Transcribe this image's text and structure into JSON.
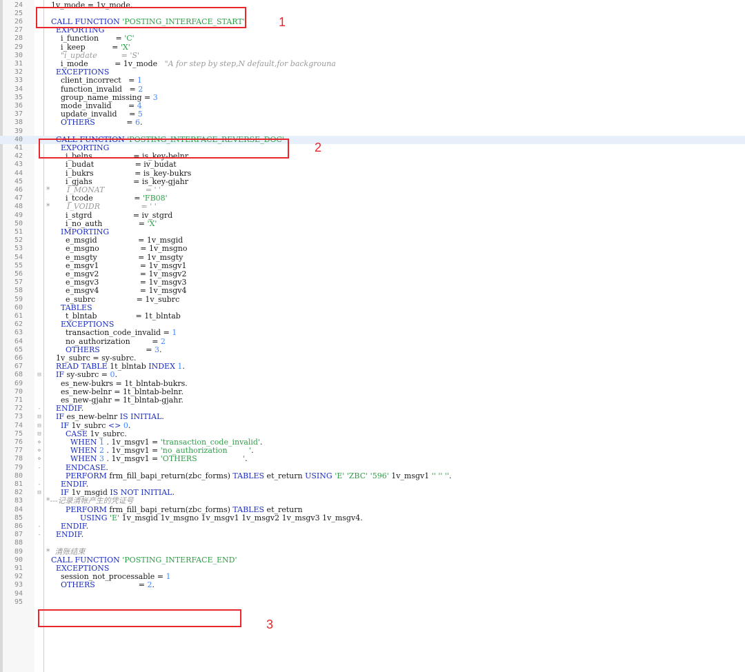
{
  "lines": [
    {
      "n": "24",
      "seg": [
        [
          "t",
          "  1v_mode = 1v_mode."
        ]
      ]
    },
    {
      "n": "25",
      "seg": []
    },
    {
      "n": "26",
      "seg": [
        [
          "t",
          "  "
        ],
        [
          "k",
          "CALL FUNCTION"
        ],
        [
          "t",
          " "
        ],
        [
          "s",
          "'POSTING_INTERFACE_START'"
        ]
      ]
    },
    {
      "n": "27",
      "seg": [
        [
          "t",
          "    "
        ],
        [
          "k",
          "EXPORTING"
        ]
      ]
    },
    {
      "n": "28",
      "seg": [
        [
          "t",
          "      i_function       = "
        ],
        [
          "s",
          "'C'"
        ]
      ]
    },
    {
      "n": "29",
      "seg": [
        [
          "t",
          "      i_keep           = "
        ],
        [
          "s",
          "'X'"
        ]
      ]
    },
    {
      "n": "30",
      "seg": [
        [
          "c",
          "      \"i_update          = 'S'"
        ]
      ]
    },
    {
      "n": "31",
      "seg": [
        [
          "t",
          "      i_mode           = 1v_mode   "
        ],
        [
          "c",
          "\"A for step by step,N default,for backgrouna"
        ]
      ]
    },
    {
      "n": "32",
      "seg": [
        [
          "t",
          "    "
        ],
        [
          "k",
          "EXCEPTIONS"
        ]
      ]
    },
    {
      "n": "33",
      "seg": [
        [
          "t",
          "      client_incorrect   = "
        ],
        [
          "n",
          "1"
        ]
      ]
    },
    {
      "n": "34",
      "seg": [
        [
          "t",
          "      function_invalid   = "
        ],
        [
          "n",
          "2"
        ]
      ]
    },
    {
      "n": "35",
      "seg": [
        [
          "t",
          "      group_name_missing = "
        ],
        [
          "n",
          "3"
        ]
      ]
    },
    {
      "n": "36",
      "seg": [
        [
          "t",
          "      mode_invalid       = "
        ],
        [
          "n",
          "4"
        ]
      ]
    },
    {
      "n": "37",
      "seg": [
        [
          "t",
          "      update_invalid     = "
        ],
        [
          "n",
          "5"
        ]
      ]
    },
    {
      "n": "38",
      "seg": [
        [
          "t",
          "      "
        ],
        [
          "k",
          "OTHERS"
        ],
        [
          "t",
          "             = "
        ],
        [
          "n",
          "6"
        ],
        [
          "t",
          "."
        ]
      ]
    },
    {
      "n": "39",
      "seg": []
    },
    {
      "n": "40",
      "hl": true,
      "seg": [
        [
          "t",
          "    "
        ],
        [
          "k",
          "CALL FUNCTION"
        ],
        [
          "t",
          " "
        ],
        [
          "s",
          "'POSTING_INTERFACE_REVERSE_DOC'"
        ]
      ]
    },
    {
      "n": "41",
      "seg": [
        [
          "t",
          "      "
        ],
        [
          "k",
          "EXPORTING"
        ]
      ]
    },
    {
      "n": "42",
      "seg": [
        [
          "t",
          "        i_belns                 = is_key-belnr"
        ]
      ]
    },
    {
      "n": "43",
      "seg": [
        [
          "t",
          "        i_budat                 = iv_budat"
        ]
      ]
    },
    {
      "n": "44",
      "seg": [
        [
          "t",
          "        i_bukrs                 = is_key-bukrs"
        ]
      ]
    },
    {
      "n": "45",
      "seg": [
        [
          "t",
          "        i_gjahs                 = is_key-gjahr"
        ]
      ]
    },
    {
      "n": "46",
      "seg": [
        [
          "c",
          "*       I_MONAT                 = ' '"
        ]
      ]
    },
    {
      "n": "47",
      "seg": [
        [
          "t",
          "        i_tcode                 = "
        ],
        [
          "s",
          "'FB08'"
        ]
      ]
    },
    {
      "n": "48",
      "seg": [
        [
          "c",
          "*       I_VOIDR                 = ' '"
        ]
      ]
    },
    {
      "n": "49",
      "seg": [
        [
          "t",
          "        i_stgrd                 = iv_stgrd"
        ]
      ]
    },
    {
      "n": "50",
      "seg": [
        [
          "t",
          "        i_no_auth               = "
        ],
        [
          "s",
          "'X'"
        ]
      ]
    },
    {
      "n": "51",
      "seg": [
        [
          "t",
          "      "
        ],
        [
          "k",
          "IMPORTING"
        ]
      ]
    },
    {
      "n": "52",
      "seg": [
        [
          "t",
          "        e_msgid                 = 1v_msgid"
        ]
      ]
    },
    {
      "n": "53",
      "seg": [
        [
          "t",
          "        e_msgno                 = 1v_msgno"
        ]
      ]
    },
    {
      "n": "54",
      "seg": [
        [
          "t",
          "        e_msgty                 = 1v_msgty"
        ]
      ]
    },
    {
      "n": "55",
      "seg": [
        [
          "t",
          "        e_msgv1                 = 1v_msgv1"
        ]
      ]
    },
    {
      "n": "56",
      "seg": [
        [
          "t",
          "        e_msgv2                 = 1v_msgv2"
        ]
      ]
    },
    {
      "n": "57",
      "seg": [
        [
          "t",
          "        e_msgv3                 = 1v_msgv3"
        ]
      ]
    },
    {
      "n": "58",
      "seg": [
        [
          "t",
          "        e_msgv4                 = 1v_msgv4"
        ]
      ]
    },
    {
      "n": "59",
      "seg": [
        [
          "t",
          "        e_subrc                 = 1v_subrc"
        ]
      ]
    },
    {
      "n": "60",
      "seg": [
        [
          "t",
          "      "
        ],
        [
          "k",
          "TABLES"
        ]
      ]
    },
    {
      "n": "61",
      "seg": [
        [
          "t",
          "        t_blntab                = 1t_blntab"
        ]
      ]
    },
    {
      "n": "62",
      "seg": [
        [
          "t",
          "      "
        ],
        [
          "k",
          "EXCEPTIONS"
        ]
      ]
    },
    {
      "n": "63",
      "seg": [
        [
          "t",
          "        transaction_code_invalid = "
        ],
        [
          "n",
          "1"
        ]
      ]
    },
    {
      "n": "64",
      "seg": [
        [
          "t",
          "        no_authorization         = "
        ],
        [
          "n",
          "2"
        ]
      ]
    },
    {
      "n": "65",
      "seg": [
        [
          "t",
          "        "
        ],
        [
          "k",
          "OTHERS"
        ],
        [
          "t",
          "                   = "
        ],
        [
          "n",
          "3"
        ],
        [
          "t",
          "."
        ]
      ]
    },
    {
      "n": "66",
      "seg": [
        [
          "t",
          "    1v_subrc = sy-subrc."
        ]
      ]
    },
    {
      "n": "67",
      "seg": [
        [
          "t",
          "    "
        ],
        [
          "k",
          "READ TABLE"
        ],
        [
          "t",
          " 1t_blntab "
        ],
        [
          "k",
          "INDEX"
        ],
        [
          "t",
          " "
        ],
        [
          "n",
          "1"
        ],
        [
          "t",
          "."
        ]
      ]
    },
    {
      "n": "68",
      "fold": "⊟",
      "seg": [
        [
          "t",
          "    "
        ],
        [
          "k",
          "IF"
        ],
        [
          "t",
          " sy-subrc = "
        ],
        [
          "n",
          "0"
        ],
        [
          "t",
          "."
        ]
      ]
    },
    {
      "n": "69",
      "seg": [
        [
          "t",
          "      es_new-bukrs = 1t_blntab-bukrs."
        ]
      ]
    },
    {
      "n": "70",
      "seg": [
        [
          "t",
          "      es_new-belnr = 1t_blntab-belnr."
        ]
      ]
    },
    {
      "n": "71",
      "seg": [
        [
          "t",
          "      es_new-gjahr = 1t_blntab-gjahr."
        ]
      ]
    },
    {
      "n": "72",
      "fold": "-",
      "seg": [
        [
          "t",
          "    "
        ],
        [
          "k",
          "ENDIF"
        ],
        [
          "t",
          "."
        ]
      ]
    },
    {
      "n": "73",
      "fold": "⊟",
      "seg": [
        [
          "t",
          "    "
        ],
        [
          "k",
          "IF"
        ],
        [
          "t",
          " es_new-belnr "
        ],
        [
          "k",
          "IS INITIAL"
        ],
        [
          "t",
          "."
        ]
      ]
    },
    {
      "n": "74",
      "fold": "⊟",
      "seg": [
        [
          "t",
          "      "
        ],
        [
          "k",
          "IF"
        ],
        [
          "t",
          " 1v_subrc "
        ],
        [
          "k",
          "<>"
        ],
        [
          "t",
          " "
        ],
        [
          "n",
          "0"
        ],
        [
          "t",
          "."
        ]
      ]
    },
    {
      "n": "75",
      "fold": "⊟",
      "seg": [
        [
          "t",
          "        "
        ],
        [
          "k",
          "CASE"
        ],
        [
          "t",
          " 1v_subrc."
        ]
      ]
    },
    {
      "n": "76",
      "fold": "⋄",
      "seg": [
        [
          "t",
          "          "
        ],
        [
          "k",
          "WHEN"
        ],
        [
          "t",
          " "
        ],
        [
          "n",
          "1"
        ],
        [
          "t",
          " . 1v_msgv1 = "
        ],
        [
          "s",
          "'transaction_code_invalid'"
        ],
        [
          "t",
          "."
        ]
      ]
    },
    {
      "n": "77",
      "fold": "⋄",
      "seg": [
        [
          "t",
          "          "
        ],
        [
          "k",
          "WHEN"
        ],
        [
          "t",
          " "
        ],
        [
          "n",
          "2"
        ],
        [
          "t",
          " . 1v_msgv1 = "
        ],
        [
          "s",
          "'no_authorization         '"
        ],
        [
          "t",
          "."
        ]
      ]
    },
    {
      "n": "78",
      "fold": "⋄",
      "seg": [
        [
          "t",
          "          "
        ],
        [
          "k",
          "WHEN"
        ],
        [
          "t",
          " "
        ],
        [
          "n",
          "3"
        ],
        [
          "t",
          " . 1v_msgv1 = "
        ],
        [
          "s",
          "'OTHERS                   '"
        ],
        [
          "t",
          "."
        ]
      ]
    },
    {
      "n": "79",
      "fold": "-",
      "seg": [
        [
          "t",
          "        "
        ],
        [
          "k",
          "ENDCASE"
        ],
        [
          "t",
          "."
        ]
      ]
    },
    {
      "n": "80",
      "seg": [
        [
          "t",
          "        "
        ],
        [
          "k",
          "PERFORM"
        ],
        [
          "t",
          " frm_fill_bapi_return(zbc_forms) "
        ],
        [
          "k",
          "TABLES"
        ],
        [
          "t",
          " et_return "
        ],
        [
          "k",
          "USING"
        ],
        [
          "t",
          " "
        ],
        [
          "s",
          "'E'"
        ],
        [
          "t",
          " "
        ],
        [
          "s",
          "'ZBC'"
        ],
        [
          "t",
          " "
        ],
        [
          "s",
          "'596'"
        ],
        [
          "t",
          " 1v_msgv1 "
        ],
        [
          "s",
          "''"
        ],
        [
          "t",
          " "
        ],
        [
          "s",
          "''"
        ],
        [
          "t",
          " "
        ],
        [
          "s",
          "''"
        ],
        [
          "t",
          "."
        ]
      ]
    },
    {
      "n": "81",
      "fold": "-",
      "seg": [
        [
          "t",
          "      "
        ],
        [
          "k",
          "ENDIF"
        ],
        [
          "t",
          "."
        ]
      ]
    },
    {
      "n": "82",
      "fold": "⊟",
      "seg": [
        [
          "t",
          "      "
        ],
        [
          "k",
          "IF"
        ],
        [
          "t",
          " 1v_msgid "
        ],
        [
          "k",
          "IS NOT INITIAL"
        ],
        [
          "t",
          "."
        ]
      ]
    },
    {
      "n": "83",
      "seg": [
        [
          "c",
          "*---记录清帐产生的凭证号"
        ]
      ]
    },
    {
      "n": "84",
      "seg": [
        [
          "t",
          "        "
        ],
        [
          "k",
          "PERFORM"
        ],
        [
          "t",
          " frm_fill_bapi_return(zbc_forms) "
        ],
        [
          "k",
          "TABLES"
        ],
        [
          "t",
          " et_return"
        ]
      ]
    },
    {
      "n": "85",
      "seg": [
        [
          "t",
          "              "
        ],
        [
          "k",
          "USING"
        ],
        [
          "t",
          " "
        ],
        [
          "s",
          "'E'"
        ],
        [
          "t",
          " 1v_msgid 1v_msgno 1v_msgv1 1v_msgv2 1v_msgv3 1v_msgv4."
        ]
      ]
    },
    {
      "n": "86",
      "fold": "-",
      "seg": [
        [
          "t",
          "      "
        ],
        [
          "k",
          "ENDIF"
        ],
        [
          "t",
          "."
        ]
      ]
    },
    {
      "n": "87",
      "fold": "-",
      "seg": [
        [
          "t",
          "    "
        ],
        [
          "k",
          "ENDIF"
        ],
        [
          "t",
          "."
        ]
      ]
    },
    {
      "n": "88",
      "seg": []
    },
    {
      "n": "89",
      "seg": [
        [
          "c",
          "*  清账结束"
        ]
      ]
    },
    {
      "n": "90",
      "seg": [
        [
          "t",
          "  "
        ],
        [
          "k",
          "CALL FUNCTION"
        ],
        [
          "t",
          " "
        ],
        [
          "s",
          "'POSTING_INTERFACE_END'"
        ]
      ]
    },
    {
      "n": "91",
      "seg": [
        [
          "t",
          "    "
        ],
        [
          "k",
          "EXCEPTIONS"
        ]
      ]
    },
    {
      "n": "92",
      "seg": [
        [
          "t",
          "      session_not_processable = "
        ],
        [
          "n",
          "1"
        ]
      ]
    },
    {
      "n": "93",
      "seg": [
        [
          "t",
          "      "
        ],
        [
          "k",
          "OTHERS"
        ],
        [
          "t",
          "                  = "
        ],
        [
          "n",
          "2"
        ],
        [
          "t",
          "."
        ]
      ]
    },
    {
      "n": "94",
      "seg": []
    },
    {
      "n": "95",
      "seg": []
    }
  ],
  "annotations": [
    {
      "label": "1"
    },
    {
      "label": "2"
    },
    {
      "label": "3"
    }
  ],
  "colors": {
    "keyword": "#1a2cc0",
    "string": "#2e9e47",
    "number": "#3f86ff",
    "comment": "#9a9a9a",
    "annotation": "#e8262c",
    "current_line": "#e6effa"
  }
}
